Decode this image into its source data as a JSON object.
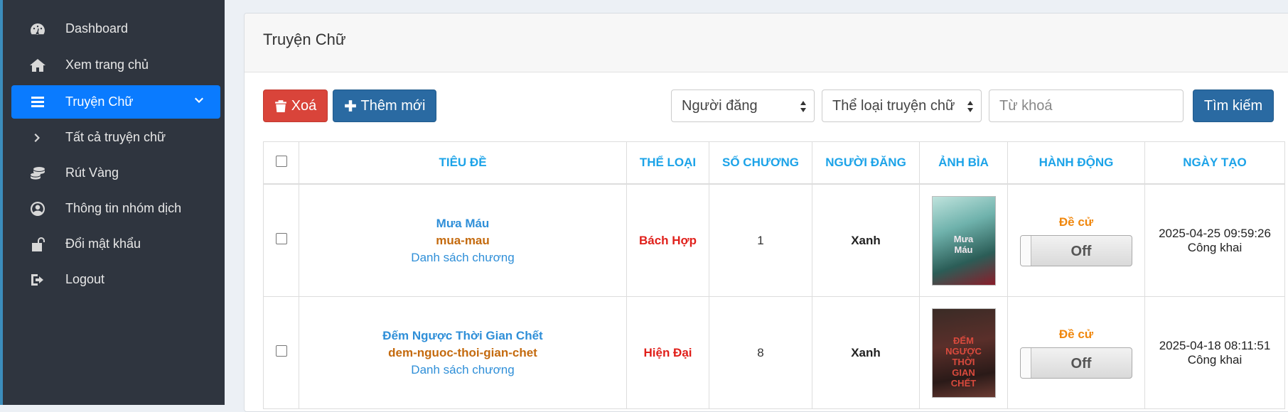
{
  "sidebar": {
    "items": [
      {
        "label": "Dashboard",
        "icon": "dashboard-icon"
      },
      {
        "label": "Xem trang chủ",
        "icon": "home-icon"
      },
      {
        "label": "Truyện Chữ",
        "icon": "list-icon",
        "active": true
      },
      {
        "label": "Tất cả truyện chữ",
        "icon": "chevron-right-icon"
      },
      {
        "label": "Rút Vàng",
        "icon": "coins-icon"
      },
      {
        "label": "Thông tin nhóm dịch",
        "icon": "user-circle-icon"
      },
      {
        "label": "Đổi mật khẩu",
        "icon": "unlock-icon"
      },
      {
        "label": "Logout",
        "icon": "sign-out-icon"
      }
    ]
  },
  "header": {
    "title": "Truyện Chữ"
  },
  "toolbar": {
    "delete_label": "Xoá",
    "add_label": "Thêm mới",
    "poster_select": "Người đăng",
    "category_select": "Thể loại truyện chữ",
    "search_placeholder": "Từ khoá",
    "search_label": "Tìm kiếm"
  },
  "table": {
    "columns": [
      "TIÊU ĐỀ",
      "THỂ LOẠI",
      "SỐ CHƯƠNG",
      "NGƯỜI ĐĂNG",
      "ẢNH BÌA",
      "HÀNH ĐỘNG",
      "NGÀY TẠO"
    ],
    "rows": [
      {
        "title": "Mưa Máu",
        "slug": "mua-mau",
        "chapter_link": "Danh sách chương",
        "category": "Bách Hợp",
        "chapters": "1",
        "poster": "Xanh",
        "nominate": "Đề cử",
        "toggle": "Off",
        "created": "2025-04-25 09:59:26",
        "visibility": "Công khai"
      },
      {
        "title": "Đếm Ngược Thời Gian Chết",
        "slug": "dem-nguoc-thoi-gian-chet",
        "chapter_link": "Danh sách chương",
        "category": "Hiện Đại",
        "chapters": "8",
        "poster": "Xanh",
        "nominate": "Đề cử",
        "toggle": "Off",
        "created": "2025-04-18 08:11:51",
        "visibility": "Công khai"
      }
    ]
  },
  "colors": {
    "sidebar_bg": "#2f353f",
    "active_bg": "#0a7bff",
    "header_text": "#1ca3e8",
    "delete_btn": "#d9443a",
    "primary_btn": "#2a6aa2",
    "category_text": "#e0201b",
    "slug_text": "#c46a0e",
    "nominate_text": "#f0870d"
  }
}
